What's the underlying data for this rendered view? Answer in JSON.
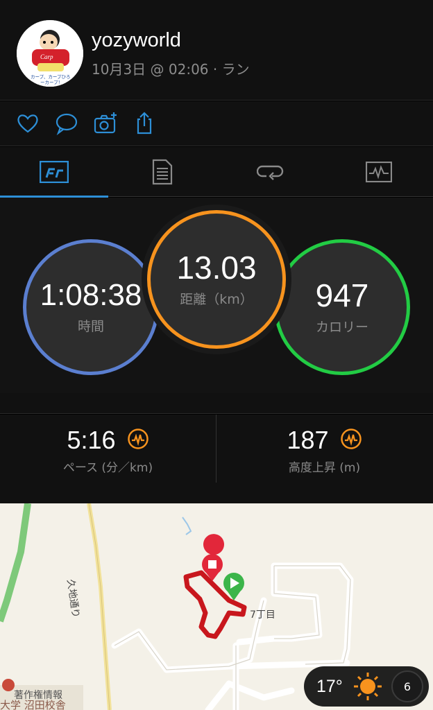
{
  "header": {
    "username": "yozyworld",
    "meta": "10月3日 @ 02:06 · ラン"
  },
  "avatar_lines": [
    "Carp",
    "カープ、カープひろ",
    "ーカープ！"
  ],
  "actions": [
    {
      "name": "heart-icon"
    },
    {
      "name": "comment-icon"
    },
    {
      "name": "add-photo-icon"
    },
    {
      "name": "share-icon"
    }
  ],
  "tabs": [
    {
      "name": "overview-icon",
      "active": true
    },
    {
      "name": "details-icon",
      "active": false
    },
    {
      "name": "laps-icon",
      "active": false
    },
    {
      "name": "graph-icon",
      "active": false
    }
  ],
  "rings": {
    "time": {
      "value": "1:08:38",
      "label": "時間",
      "color": "#4a90d9"
    },
    "distance": {
      "value": "13.03",
      "label": "距離（km）",
      "color": "#f7931e"
    },
    "calories": {
      "value": "947",
      "label": "カロリー",
      "color": "#22cc44"
    }
  },
  "metrics": {
    "pace": {
      "value": "5:16",
      "label": "ペース (分／km)"
    },
    "elevation": {
      "value": "187",
      "label": "高度上昇 (m)"
    }
  },
  "map": {
    "street": "久地通り",
    "block": "7丁目",
    "footer_left_1": "著作権情報",
    "footer_left_2": "大学 沼田校舎"
  },
  "weather": {
    "temperature": "17°",
    "wind": "6"
  },
  "colors": {
    "accent": "#2d8fd7",
    "orange": "#f7931e",
    "green": "#22cc44",
    "route": "#c8171d"
  }
}
